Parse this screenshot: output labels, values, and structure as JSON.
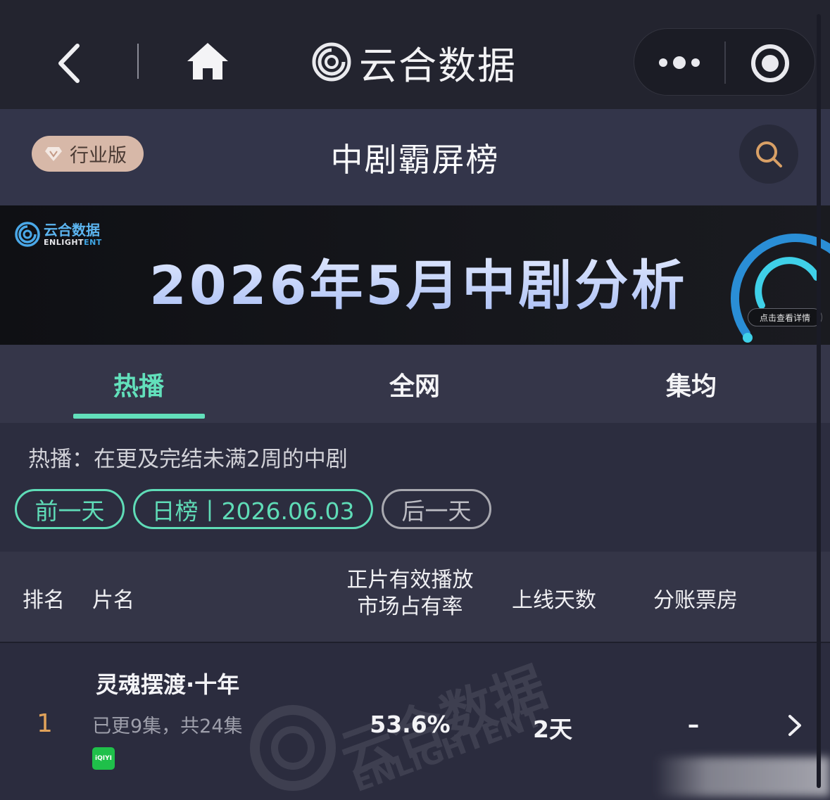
{
  "nav": {
    "brand_name": "云合数据",
    "icons": {
      "back": "chevron-left-icon",
      "home": "home-icon",
      "more": "more-dots-icon",
      "close": "target-circle-icon"
    }
  },
  "header": {
    "edition_label": "行业版",
    "title": "中剧霸屏榜",
    "search_icon": "search-icon"
  },
  "banner": {
    "logo_cn": "云合数据",
    "logo_en_main": "ENLIGHT",
    "logo_en_accent": "ENT",
    "title": "2026年5月中剧分析",
    "cta": "点击查看详情"
  },
  "tabs": [
    {
      "label": "热播",
      "active": true
    },
    {
      "label": "全网",
      "active": false
    },
    {
      "label": "集均",
      "active": false
    }
  ],
  "filter": {
    "description": "热播：在更及完结未满2周的中剧",
    "prev_label": "前一天",
    "current_label": "日榜丨2026.06.03",
    "next_label": "后一天"
  },
  "table": {
    "columns": {
      "rank": "排名",
      "title": "片名",
      "share_line1": "正片有效播放",
      "share_line2": "市场占有率",
      "days": "上线天数",
      "box_office": "分账票房"
    },
    "rows": [
      {
        "rank": "1",
        "title": "灵魂摆渡·十年",
        "episodes": "已更9集，共24集",
        "platform": "iQIYI",
        "share": "53.6%",
        "days": "2天",
        "box_office": "–"
      }
    ]
  },
  "watermark": {
    "cn": "云合数据",
    "en": "ENLIGHTENT"
  },
  "colors": {
    "accent": "#62e0bb",
    "rank": "#e0a25a",
    "edition_bg": "#d7b8a8",
    "topbar_bg": "#23242f",
    "header_bg": "#33354a"
  }
}
